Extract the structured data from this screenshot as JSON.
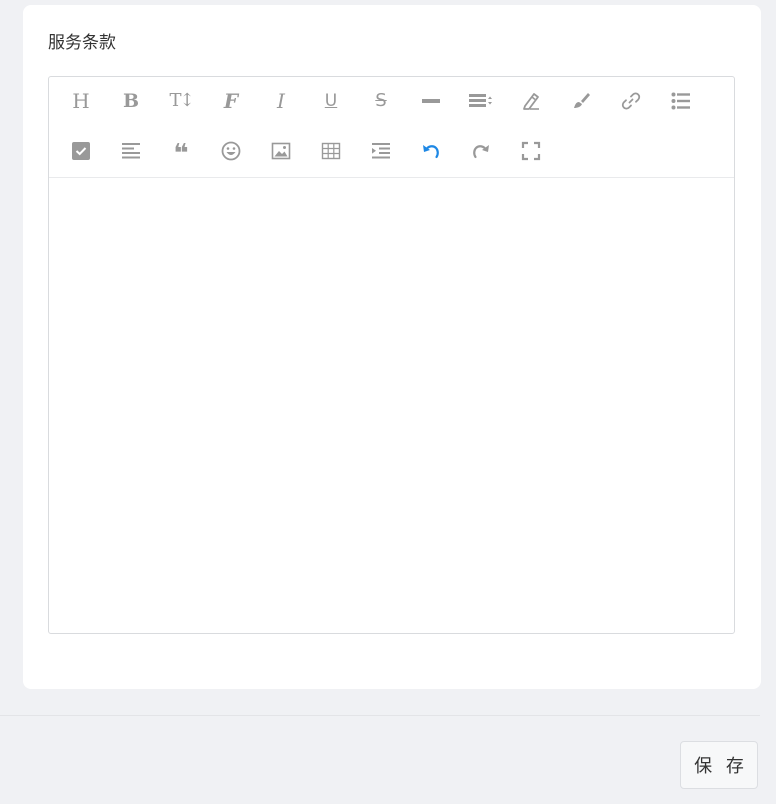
{
  "section": {
    "title": "服务条款"
  },
  "toolbar": {
    "row1": [
      {
        "name": "heading-icon",
        "glyph": "H"
      },
      {
        "name": "bold-icon",
        "glyph": "B"
      },
      {
        "name": "font-size-icon",
        "glyph": "T↕"
      },
      {
        "name": "font-family-icon",
        "glyph": "F"
      },
      {
        "name": "italic-icon",
        "glyph": "I"
      },
      {
        "name": "underline-icon",
        "glyph": "U"
      },
      {
        "name": "strikethrough-icon",
        "glyph": "S"
      },
      {
        "name": "horizontal-rule-icon"
      },
      {
        "name": "line-height-icon"
      },
      {
        "name": "text-color-icon"
      },
      {
        "name": "background-color-icon"
      },
      {
        "name": "link-icon"
      },
      {
        "name": "unordered-list-icon"
      }
    ],
    "row2": [
      {
        "name": "todo-checkbox-icon"
      },
      {
        "name": "align-left-icon"
      },
      {
        "name": "quote-icon",
        "glyph": "❝"
      },
      {
        "name": "emoji-icon"
      },
      {
        "name": "image-icon"
      },
      {
        "name": "table-icon"
      },
      {
        "name": "indent-icon"
      },
      {
        "name": "undo-icon",
        "color": "#1e88e5"
      },
      {
        "name": "redo-icon"
      },
      {
        "name": "fullscreen-icon"
      }
    ]
  },
  "editor": {
    "content": ""
  },
  "actions": {
    "save_label": "保存"
  }
}
